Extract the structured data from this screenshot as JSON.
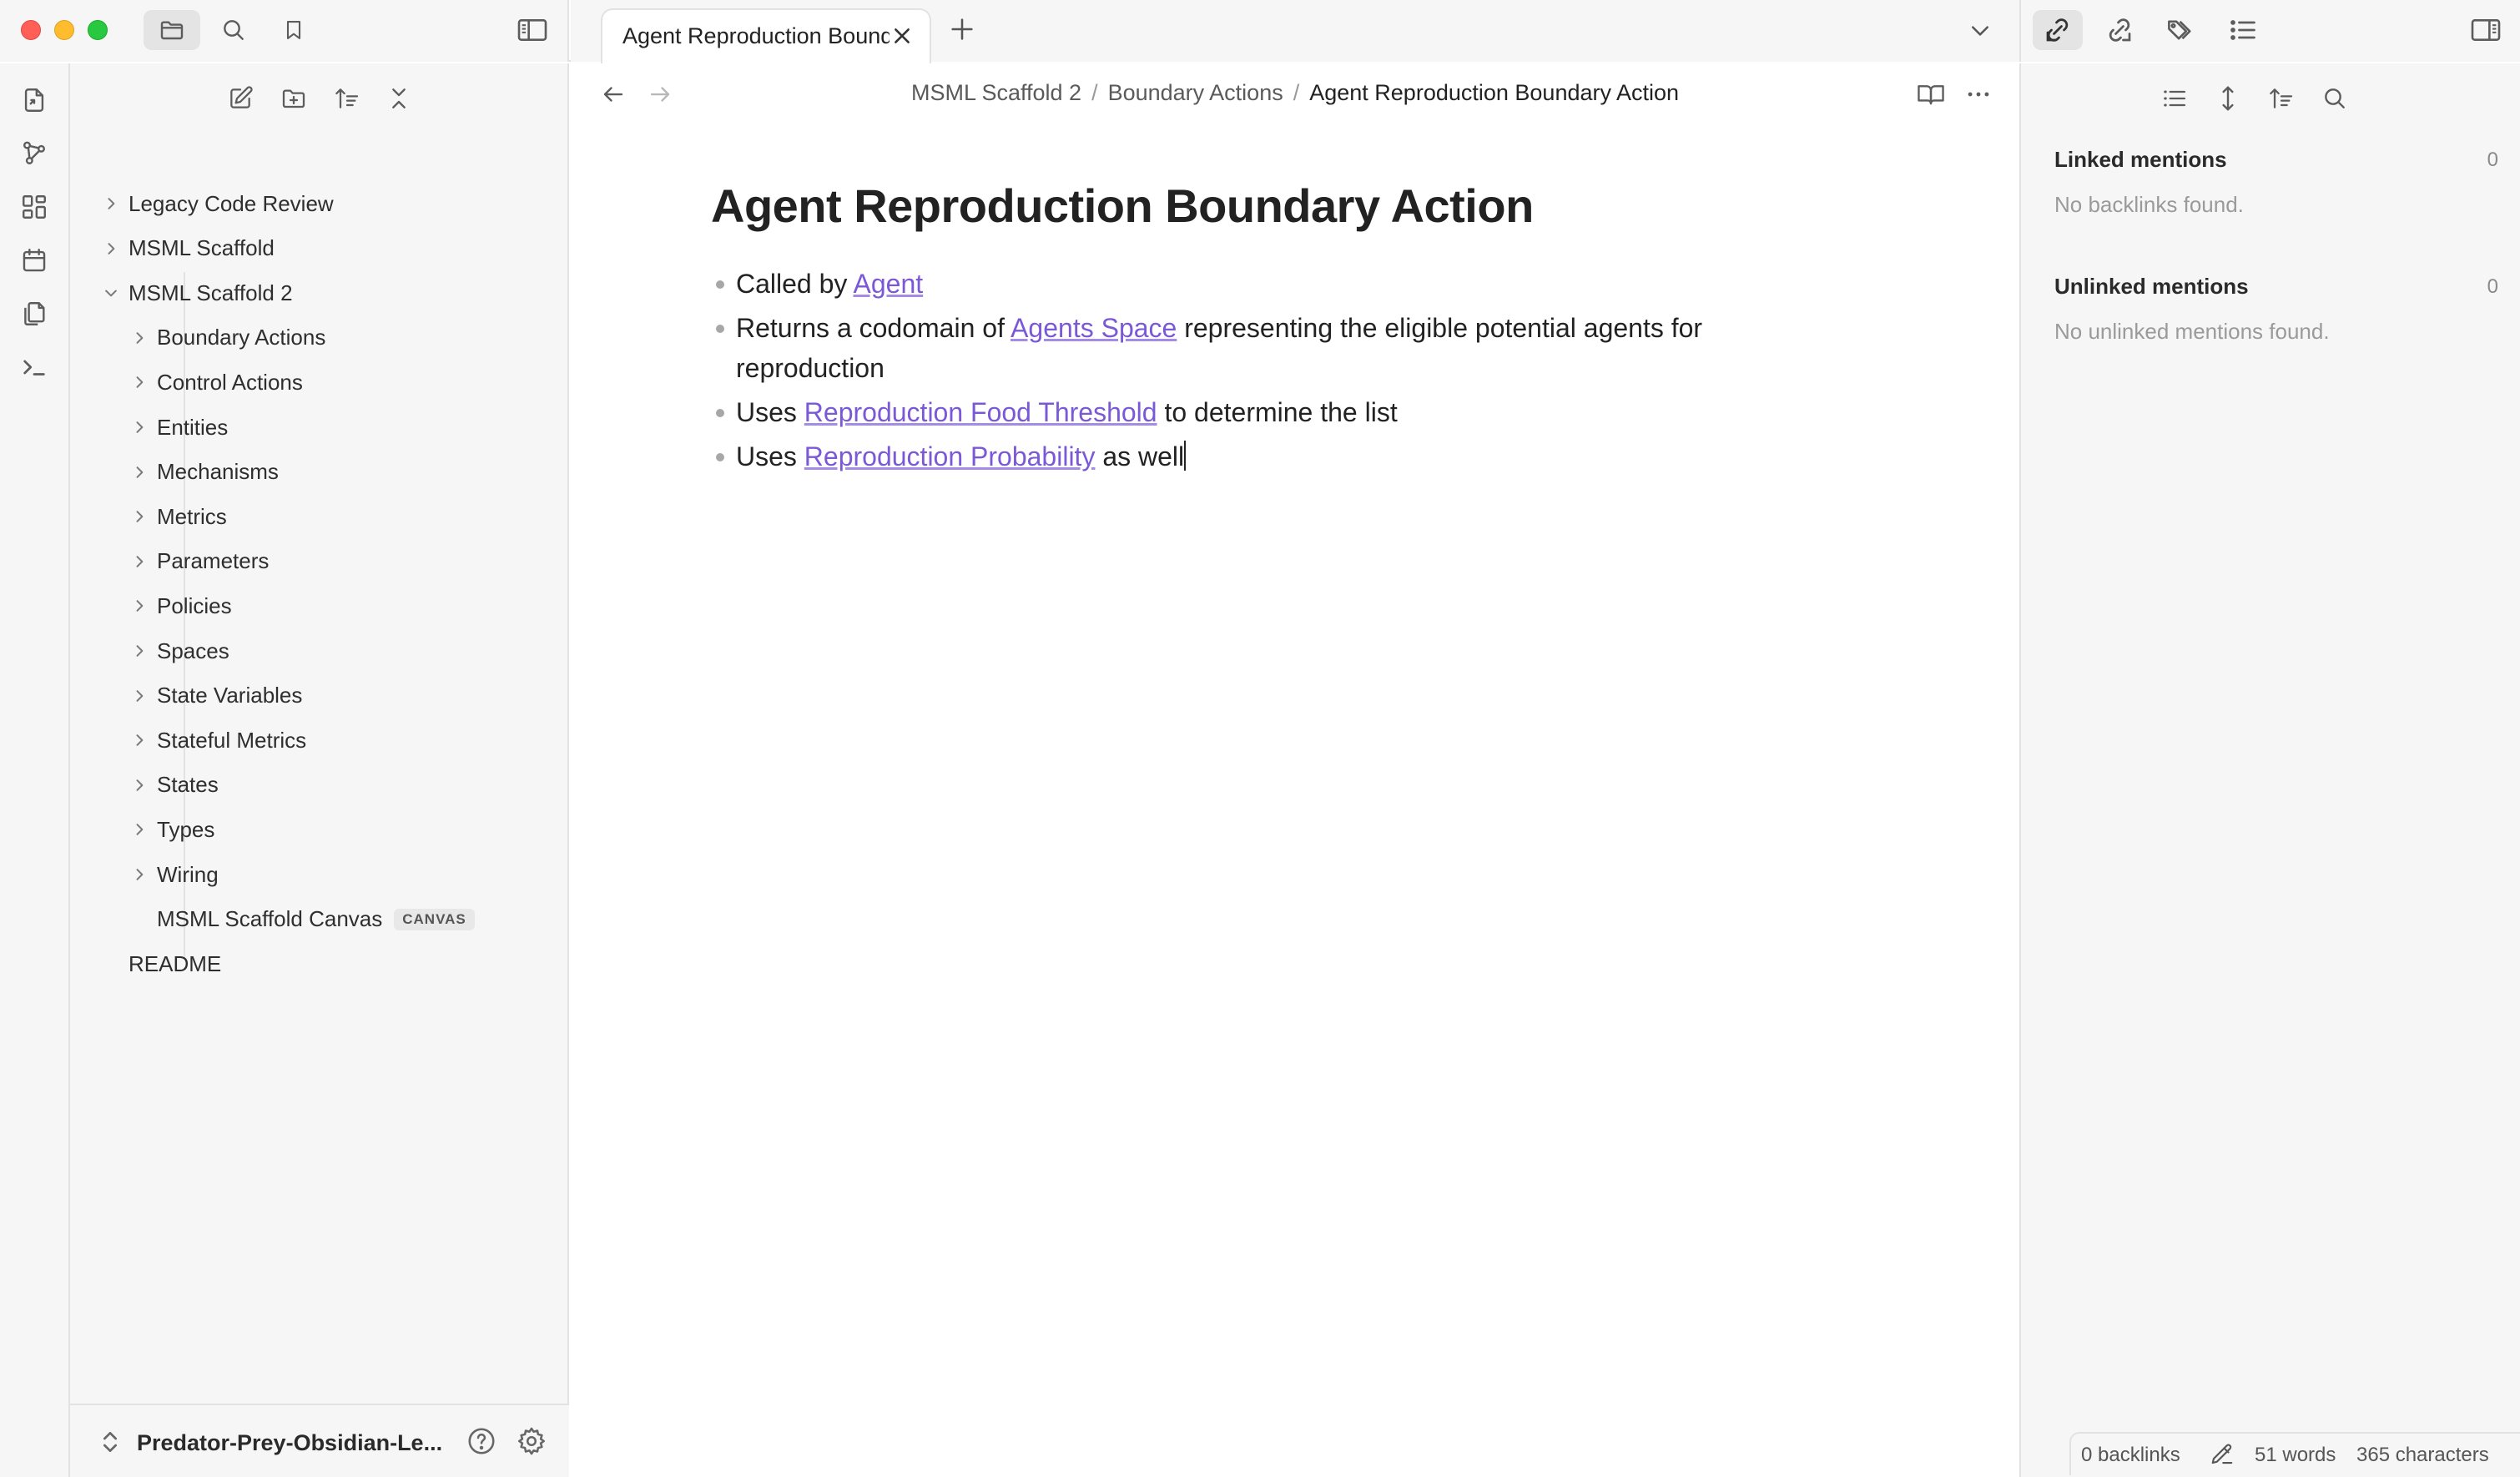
{
  "window": {
    "traffic_lights": {
      "close": "#ff5f57",
      "minimize": "#febc2e",
      "zoom": "#28c840"
    },
    "top_icons": [
      "folder-icon",
      "search-icon",
      "bookmark-icon",
      "sidebar-left-toggle-icon"
    ]
  },
  "tabs": {
    "active": {
      "title": "Agent Reproduction Boundary Action"
    },
    "new_tab_icon": "plus-icon",
    "tab_list_icon": "chevron-down-icon"
  },
  "ribbon": {
    "icons": [
      "open-quick-switcher-icon",
      "graph-view-icon",
      "canvas-icon",
      "daily-note-icon",
      "templates-icon",
      "command-palette-icon"
    ]
  },
  "explorer": {
    "actions": [
      "new-note-icon",
      "new-folder-icon",
      "sort-order-icon",
      "collapse-all-icon"
    ],
    "items": [
      {
        "label": "Legacy Code Review",
        "type": "folder",
        "expanded": false,
        "level": 0
      },
      {
        "label": "MSML Scaffold",
        "type": "folder",
        "expanded": false,
        "level": 0
      },
      {
        "label": "MSML Scaffold 2",
        "type": "folder",
        "expanded": true,
        "level": 0
      },
      {
        "label": "Boundary Actions",
        "type": "folder",
        "expanded": false,
        "level": 1
      },
      {
        "label": "Control Actions",
        "type": "folder",
        "expanded": false,
        "level": 1
      },
      {
        "label": "Entities",
        "type": "folder",
        "expanded": false,
        "level": 1
      },
      {
        "label": "Mechanisms",
        "type": "folder",
        "expanded": false,
        "level": 1
      },
      {
        "label": "Metrics",
        "type": "folder",
        "expanded": false,
        "level": 1
      },
      {
        "label": "Parameters",
        "type": "folder",
        "expanded": false,
        "level": 1
      },
      {
        "label": "Policies",
        "type": "folder",
        "expanded": false,
        "level": 1
      },
      {
        "label": "Spaces",
        "type": "folder",
        "expanded": false,
        "level": 1
      },
      {
        "label": "State Variables",
        "type": "folder",
        "expanded": false,
        "level": 1
      },
      {
        "label": "Stateful Metrics",
        "type": "folder",
        "expanded": false,
        "level": 1
      },
      {
        "label": "States",
        "type": "folder",
        "expanded": false,
        "level": 1
      },
      {
        "label": "Types",
        "type": "folder",
        "expanded": false,
        "level": 1
      },
      {
        "label": "Wiring",
        "type": "folder",
        "expanded": false,
        "level": 1
      },
      {
        "label": "MSML Scaffold Canvas",
        "type": "file",
        "badge": "CANVAS",
        "level": 1
      },
      {
        "label": "README",
        "type": "file",
        "level": 0
      }
    ],
    "vault": {
      "name": "Predator-Prey-Obsidian-Le..."
    }
  },
  "editor": {
    "breadcrumb": [
      "MSML Scaffold 2",
      "Boundary Actions",
      "Agent Reproduction Boundary Action"
    ],
    "breadcrumb_sep": "/",
    "title": "Agent Reproduction Boundary Action",
    "bullets": [
      {
        "parts": [
          {
            "t": "Called by "
          },
          {
            "t": "Agent",
            "link": true
          }
        ]
      },
      {
        "parts": [
          {
            "t": "Returns a codomain of "
          },
          {
            "t": "Agents Space",
            "link": true
          },
          {
            "t": " representing the eligible potential agents for reproduction"
          }
        ]
      },
      {
        "parts": [
          {
            "t": "Uses "
          },
          {
            "t": "Reproduction Food Threshold",
            "link": true
          },
          {
            "t": " to determine the list"
          }
        ]
      },
      {
        "parts": [
          {
            "t": "Uses "
          },
          {
            "t": "Reproduction Probability",
            "link": true
          },
          {
            "t": " as well"
          }
        ],
        "caret": true
      }
    ],
    "link_color": "#7a58d6"
  },
  "right_sidebar": {
    "tabs": [
      "backlinks-icon",
      "outgoing-links-icon",
      "tags-icon",
      "outline-icon"
    ],
    "toolbar": [
      "list-icon",
      "expand-icon",
      "sort-icon",
      "search-icon"
    ],
    "linked": {
      "title": "Linked mentions",
      "count": "0",
      "empty": "No backlinks found."
    },
    "unlinked": {
      "title": "Unlinked mentions",
      "count": "0",
      "empty": "No unlinked mentions found."
    }
  },
  "status": {
    "backlinks": "0 backlinks",
    "words": "51 words",
    "characters": "365 characters"
  }
}
